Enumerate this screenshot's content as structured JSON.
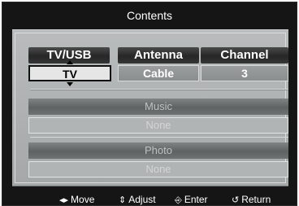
{
  "window": {
    "title": "Contents"
  },
  "columns": [
    {
      "header": "TV/USB",
      "value": "TV",
      "selected": true
    },
    {
      "header": "Antenna",
      "value": "Cable",
      "selected": false
    },
    {
      "header": "Channel",
      "value": "3",
      "selected": false
    }
  ],
  "rows": [
    {
      "label": "Music",
      "value": "None"
    },
    {
      "label": "Photo",
      "value": "None"
    }
  ],
  "footer": {
    "move": "Move",
    "adjust": "Adjust",
    "enter": "Enter",
    "return": "Return"
  },
  "icons": {
    "move": "left-right-arrows-icon",
    "adjust": "up-down-arrows-icon",
    "enter": "enter-icon",
    "return": "return-icon"
  }
}
